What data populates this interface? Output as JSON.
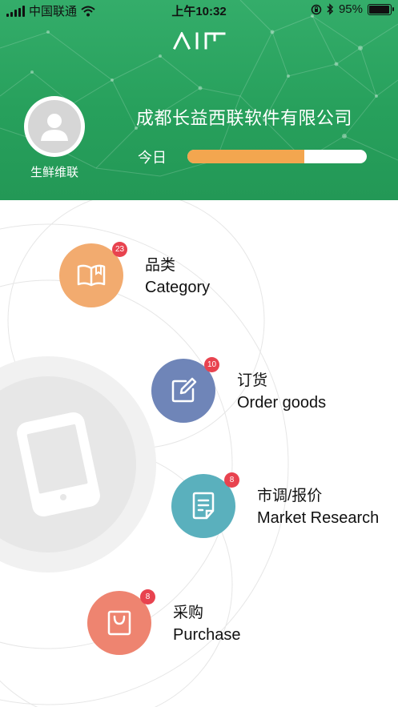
{
  "status_bar": {
    "carrier": "中国联通",
    "time": "上午10:32",
    "battery": "95%",
    "battery_level": 0.95,
    "icons": [
      "signal-icon",
      "wifi-icon",
      "rotation-lock-icon",
      "bluetooth-icon",
      "battery-icon"
    ]
  },
  "header": {
    "logo": "AIF",
    "avatar_name": "生鲜维联",
    "company": "成都长益西联软件有限公司",
    "today_label": "今日",
    "today_progress": 0.65,
    "colors": {
      "header_green": "#2aa35f",
      "progress": "#f3a64f"
    }
  },
  "menu": [
    {
      "id": "category",
      "label_cn": "品类",
      "label_en": "Category",
      "badge": "23",
      "color": "#f2ab6f",
      "icon": "book-icon"
    },
    {
      "id": "order",
      "label_cn": "订货",
      "label_en": "Order goods",
      "badge": "10",
      "color": "#6f85b8",
      "icon": "edit-icon"
    },
    {
      "id": "market",
      "label_cn": "市调/报价",
      "label_en": "Market Research",
      "badge": "8",
      "color": "#5ab0bd",
      "icon": "document-icon"
    },
    {
      "id": "purchase",
      "label_cn": "采购",
      "label_en": "Purchase",
      "badge": "8",
      "color": "#ee8470",
      "icon": "shopping-bag-icon"
    }
  ]
}
